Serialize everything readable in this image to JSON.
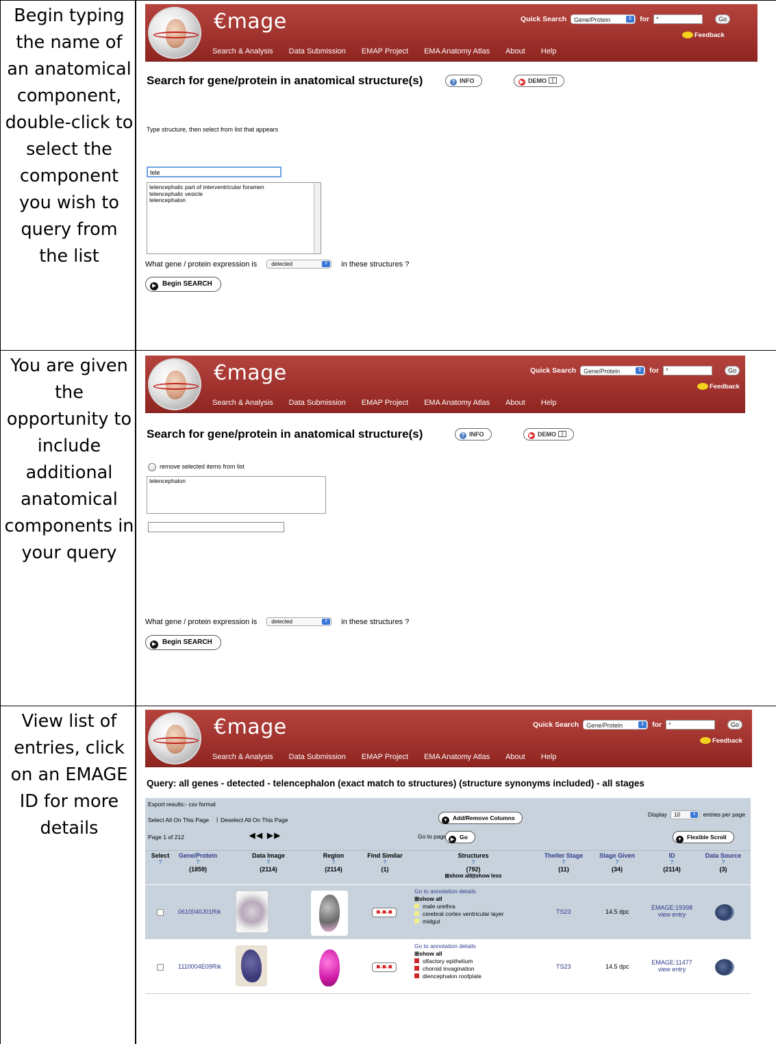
{
  "steps": [
    "Begin typing the name of an anatomical component, double-click to select the component you wish to query from the list",
    "You are given the opportunity to include additional anatomical components in your query",
    "View list of entries, click on an EMAGE ID for more details"
  ],
  "header": {
    "brand": "€mage",
    "quick_search_label": "Quick Search",
    "quick_search_option": "Gene/Protein",
    "for_label": "for",
    "search_value": "*",
    "go_label": "Go",
    "feedback_label": "Feedback",
    "nav": [
      "Search & Analysis",
      "Data Submission",
      "EMAP Project",
      "EMA Anatomy Atlas",
      "About",
      "Help"
    ]
  },
  "search_page": {
    "title": "Search for gene/protein in anatomical structure(s)",
    "info_label": "INFO",
    "demo_label": "DEMO",
    "instruction": "Type structure, then select from list that appears",
    "typed_text": "tele",
    "suggestions": [
      "telencephalic part of interventricular foramen",
      "telencephalic vesicle",
      "telencephalon"
    ],
    "remove_label": "remove selected items from list",
    "selected_items": [
      "telencephalon"
    ],
    "expression_prefix": "What gene / protein expression is",
    "expression_option": "detected",
    "expression_suffix": "in these structures ?",
    "begin_label": "Begin SEARCH"
  },
  "results": {
    "query": "Query: all genes - detected - telencephalon (exact match to structures) (structure synonyms included) - all stages",
    "export": "Export results:- csv format",
    "select_all": "Select All On This Page",
    "deselect_all": "Deselect All On This Page",
    "add_remove": "Add/Remove Columns",
    "display_label": "Display",
    "display_value": "10",
    "entries_label": "entries per page",
    "page_info": "Page 1 of 212",
    "pager_glyphs": "◀◀ ▶▶",
    "go_to_page": "Go to page:",
    "go_label": "Go",
    "flexible_scroll": "Flexible Scroll",
    "columns": [
      {
        "name": "Select",
        "count": ""
      },
      {
        "name": "Gene/Protein",
        "count": "(1859)"
      },
      {
        "name": "Data Image",
        "count": "(2114)"
      },
      {
        "name": "Region",
        "count": "(2114)"
      },
      {
        "name": "Find Similar",
        "count": "(1)"
      },
      {
        "name": "Structures",
        "count": "(792)"
      },
      {
        "name": "Theiler Stage",
        "count": "(11)"
      },
      {
        "name": "Stage Given",
        "count": "(34)"
      },
      {
        "name": "ID",
        "count": "(2114)"
      },
      {
        "name": "Data Source",
        "count": "(3)"
      }
    ],
    "show_all": "show all",
    "show_less": "show less",
    "annotation_link": "Go to annotation details",
    "find_similar_glyph": "✖-✖-✖",
    "view_entry": "view entry",
    "rows": [
      {
        "gene": "0610040J01Rik",
        "structures": [
          "male urethra",
          "cerebral cortex ventricular layer",
          "midgut"
        ],
        "structure_color": "#f2ec8c",
        "theiler": "TS23",
        "stage": "14.5 dpc",
        "id": "EMAGE:19398"
      },
      {
        "gene": "1110004E09Rik",
        "structures": [
          "olfactory epithelium",
          "choroid invagination",
          "diencephalon roofplate"
        ],
        "structure_color": "#cc2a2a",
        "theiler": "TS23",
        "stage": "14.5 dpc",
        "id": "EMAGE:11477"
      }
    ]
  }
}
